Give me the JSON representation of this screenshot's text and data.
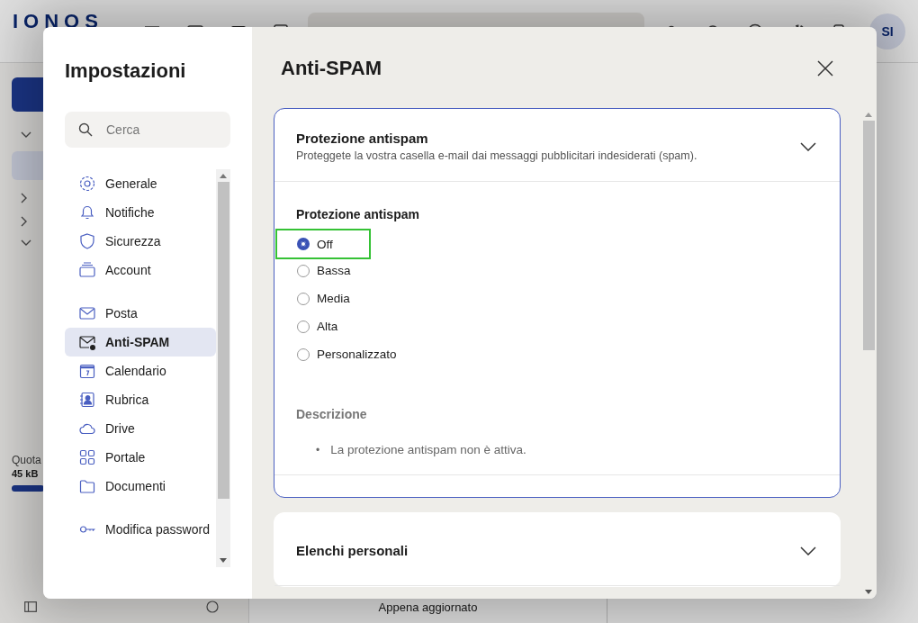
{
  "app": {
    "logo": "IONOS",
    "avatar": "SI",
    "quota_label": "Quota",
    "quota_value": "45 kB",
    "quota": {
      "level": 0.3
    },
    "status": "Appena aggiornato"
  },
  "settings": {
    "title": "Impostazioni",
    "search": {
      "placeholder": "Cerca"
    },
    "nav_groups": [
      {
        "items": [
          {
            "label": "Generale",
            "selected": false
          },
          {
            "label": "Notifiche",
            "selected": false
          },
          {
            "label": "Sicurezza",
            "selected": false
          },
          {
            "label": "Account",
            "selected": false
          }
        ]
      },
      {
        "items": [
          {
            "label": "Posta",
            "selected": false
          },
          {
            "label": "Anti-SPAM",
            "selected": true
          },
          {
            "label": "Calendario",
            "selected": false
          },
          {
            "label": "Rubrica",
            "selected": false
          },
          {
            "label": "Drive",
            "selected": false
          },
          {
            "label": "Portale",
            "selected": false
          },
          {
            "label": "Documenti",
            "selected": false
          }
        ]
      },
      {
        "items": [
          {
            "label": "Modifica password",
            "selected": false
          }
        ]
      }
    ]
  },
  "page": {
    "title": "Anti-SPAM",
    "sections": [
      {
        "title": "Protezione antispam",
        "subtitle": "Proteggete la vostra casella e-mail dai messaggi pubblicitari indesiderati (spam).",
        "expanded": true,
        "field_label": "Protezione antispam",
        "options": [
          {
            "label": "Off",
            "selected": true,
            "focused": true
          },
          {
            "label": "Bassa",
            "selected": false,
            "focused": false
          },
          {
            "label": "Media",
            "selected": false,
            "focused": false
          },
          {
            "label": "Alta",
            "selected": false,
            "focused": false
          },
          {
            "label": "Personalizzato",
            "selected": false,
            "focused": false
          }
        ],
        "description_label": "Descrizione",
        "description_items": [
          {
            "marker": "•",
            "text": "La protezione antispam non è attiva."
          }
        ]
      },
      {
        "title": "Elenchi personali",
        "expanded": false
      }
    ]
  }
}
